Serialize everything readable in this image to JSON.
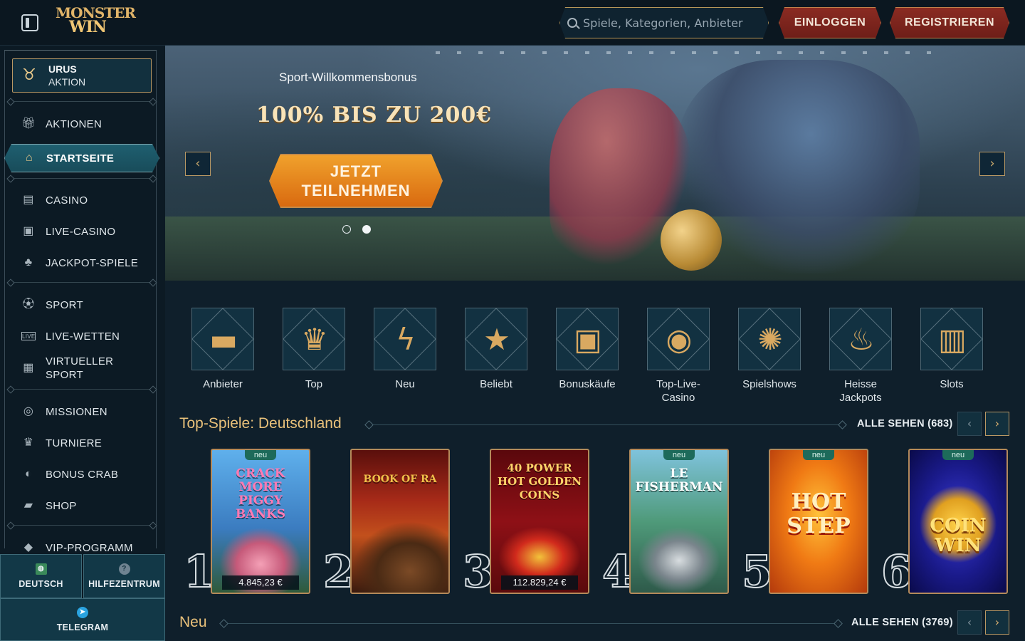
{
  "header": {
    "logo_line1": "MONSTER",
    "logo_line2": "WIN",
    "search_placeholder": "Spiele, Kategorien, Anbieter",
    "login_label": "EINLOGGEN",
    "register_label": "REGISTRIEREN"
  },
  "sidebar": {
    "promo": {
      "title": "URUS",
      "subtitle": "AKTION"
    },
    "items": [
      {
        "label": "AKTIONEN",
        "icon": "gift-icon"
      },
      {
        "label": "STARTSEITE",
        "icon": "home-icon",
        "active": true
      },
      {
        "label": "CASINO",
        "icon": "slot-machine-icon"
      },
      {
        "label": "LIVE-CASINO",
        "icon": "live-casino-icon"
      },
      {
        "label": "JACKPOT-SPIELE",
        "icon": "clover-icon"
      },
      {
        "label": "SPORT",
        "icon": "soccer-ball-icon"
      },
      {
        "label": "LIVE-WETTEN",
        "icon": "live-badge-icon"
      },
      {
        "label": "VIRTUELLER SPORT",
        "icon": "virtual-sport-icon"
      },
      {
        "label": "MISSIONEN",
        "icon": "mission-icon"
      },
      {
        "label": "TURNIERE",
        "icon": "trophy-icon"
      },
      {
        "label": "BONUS CRAB",
        "icon": "crab-icon"
      },
      {
        "label": "SHOP",
        "icon": "shopping-bag-icon"
      },
      {
        "label": "VIP-PROGRAMM",
        "icon": "diamond-icon"
      }
    ],
    "bottom": {
      "language_label": "DEUTSCH",
      "help_label": "HILFEZENTRUM",
      "telegram_label": "TELEGRAM"
    }
  },
  "banner": {
    "subtitle": "Sport-Willkommensbonus",
    "title": "100% BIS ZU 200€",
    "cta_line1": "JETZT",
    "cta_line2": "TEILNEHMEN",
    "slides_total": 2,
    "active_slide": 2
  },
  "categories": [
    {
      "label": "Anbieter",
      "icon": "book-icon"
    },
    {
      "label": "Top",
      "icon": "crown-icon"
    },
    {
      "label": "Neu",
      "icon": "lightning-icon"
    },
    {
      "label": "Beliebt",
      "icon": "star-icon"
    },
    {
      "label": "Bonuskäufe",
      "icon": "gift-box-icon"
    },
    {
      "label": "Top-Live-Casino",
      "icon": "poker-chip-icon"
    },
    {
      "label": "Spielshows",
      "icon": "wheel-icon"
    },
    {
      "label": "Heisse Jackpots",
      "icon": "flame-icon"
    },
    {
      "label": "Slots",
      "icon": "slot-icon"
    }
  ],
  "top_games": {
    "title": "Top-Spiele: Deutschland",
    "see_all": "ALLE SEHEN (683)",
    "games": [
      {
        "rank": "1",
        "title": "CRACK MORE PIGGY BANKS",
        "new": true,
        "badge": "neu",
        "amount": "4.845,23 €",
        "color": "#3e8fd6",
        "title_color": "#ff7ab3"
      },
      {
        "rank": "2",
        "title": "BOOK OF RA",
        "new": false,
        "badge": "",
        "amount": "",
        "color": "#8a1d14",
        "title_color": "#f0c14a"
      },
      {
        "rank": "3",
        "title": "40 POWER HOT GOLDEN COINS",
        "new": false,
        "badge": "",
        "amount": "112.829,24 €",
        "color": "#7a0e12",
        "title_color": "#ffd36a"
      },
      {
        "rank": "4",
        "title": "LE FISHERMAN",
        "new": true,
        "badge": "neu",
        "amount": "",
        "color": "#3e8a6a",
        "title_color": "#ffffff"
      },
      {
        "rank": "5",
        "title": "HOT STEP",
        "new": true,
        "badge": "neu",
        "amount": "",
        "color": "#e86a14",
        "title_color": "#ffe6a0"
      },
      {
        "rank": "6",
        "title": "COIN WIN",
        "new": true,
        "badge": "neu",
        "amount": "",
        "color": "#1a2a9a",
        "title_color": "#ffd24a"
      }
    ]
  },
  "new_section": {
    "title": "Neu",
    "see_all": "ALLE SEHEN (3769)"
  }
}
